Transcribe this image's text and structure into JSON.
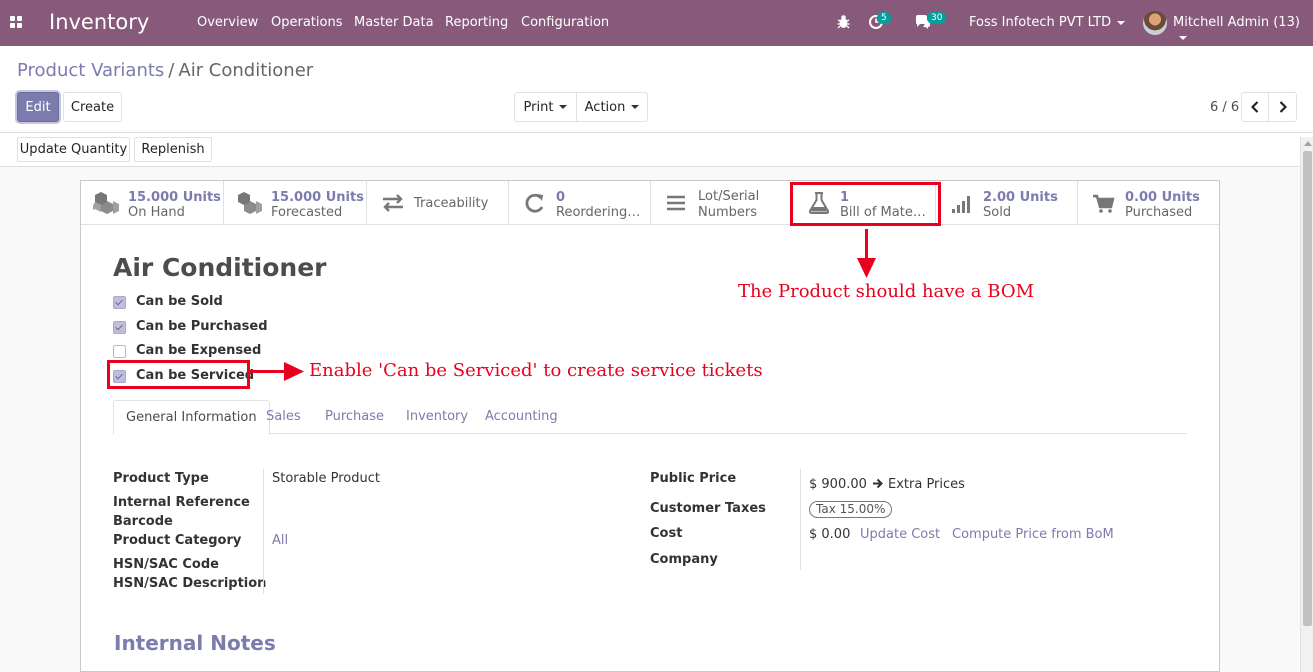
{
  "navbar": {
    "app_name": "Inventory",
    "menu": [
      "Overview",
      "Operations",
      "Master Data",
      "Reporting",
      "Configuration"
    ],
    "activity_count": "5",
    "message_count": "30",
    "company": "Foss Infotech PVT LTD",
    "user": "Mitchell Admin (13)"
  },
  "breadcrumb": {
    "parent": "Product Variants",
    "separator": "/",
    "current": "Air Conditioner"
  },
  "toolbar": {
    "edit": "Edit",
    "create": "Create",
    "print": "Print",
    "action": "Action"
  },
  "pager": {
    "value": "6 / 6"
  },
  "buttonbar": {
    "update_quantity": "Update Quantity",
    "replenish": "Replenish"
  },
  "smart_buttons": {
    "on_hand": {
      "value": "15.000 Units",
      "label": "On Hand"
    },
    "forecasted": {
      "value": "15.000 Units",
      "label": "Forecasted"
    },
    "traceability": {
      "label": "Traceability"
    },
    "reordering": {
      "value": "0",
      "label": "Reordering ..."
    },
    "lot_serial": {
      "line1": "Lot/Serial",
      "line2": "Numbers"
    },
    "bom": {
      "value": "1",
      "label": "Bill of Materi..."
    },
    "sold": {
      "value": "2.00 Units",
      "label": "Sold"
    },
    "purchased": {
      "value": "0.00 Units",
      "label": "Purchased"
    }
  },
  "product": {
    "name": "Air Conditioner",
    "can_be_sold": {
      "label": "Can be Sold",
      "checked": true
    },
    "can_be_purchased": {
      "label": "Can be Purchased",
      "checked": true
    },
    "can_be_expensed": {
      "label": "Can be Expensed",
      "checked": false
    },
    "can_be_serviced": {
      "label": "Can be Serviced",
      "checked": true
    }
  },
  "annotations": {
    "bom_note": "The Product should have a BOM",
    "serviced_note": "Enable 'Can be Serviced' to create service tickets"
  },
  "tabs": [
    "General Information",
    "Sales",
    "Purchase",
    "Inventory",
    "Accounting"
  ],
  "general": {
    "product_type_label": "Product Type",
    "product_type": "Storable Product",
    "internal_reference_label": "Internal Reference",
    "barcode_label": "Barcode",
    "product_category_label": "Product Category",
    "product_category": "All",
    "hsn_code_label": "HSN/SAC Code",
    "hsn_desc_label": "HSN/SAC Description",
    "public_price_label": "Public Price",
    "public_price": "$ 900.00",
    "extra_prices": "Extra Prices",
    "customer_taxes_label": "Customer Taxes",
    "customer_taxes": "Tax 15.00%",
    "cost_label": "Cost",
    "cost": "$ 0.00",
    "update_cost": "Update Cost",
    "compute_price": "Compute Price from BoM",
    "company_label": "Company"
  },
  "internal_notes": "Internal Notes",
  "colors": {
    "brand": "#875a7b",
    "accent": "#7c7bad",
    "annotation": "#e8001c",
    "badge": "#00a09d"
  }
}
